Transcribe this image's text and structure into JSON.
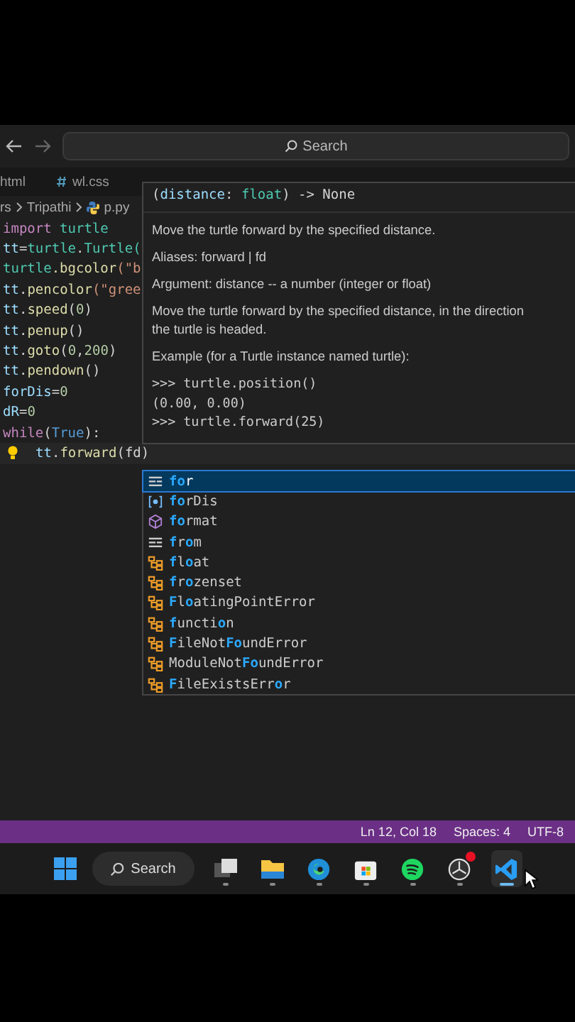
{
  "title_bar": {
    "search_label": "Search"
  },
  "tabs": [
    {
      "label": "html",
      "kind": "html",
      "selected": false
    },
    {
      "label": "wl.css",
      "kind": "css",
      "selected": false
    }
  ],
  "breadcrumbs": [
    "rs",
    "Tripathi",
    "p.py"
  ],
  "code_lines": [
    [
      {
        "text": "import ",
        "kind": "keyword"
      },
      {
        "text": "turtle",
        "kind": "module"
      }
    ],
    [
      {
        "text": "tt",
        "kind": "var"
      },
      {
        "text": "=",
        "kind": "plain"
      },
      {
        "text": "turtle",
        "kind": "module"
      },
      {
        "text": ".",
        "kind": "plain"
      },
      {
        "text": "Turtle(",
        "kind": "class"
      }
    ],
    [
      {
        "text": "turtle",
        "kind": "module"
      },
      {
        "text": ".bgcolor",
        "kind": "func"
      },
      {
        "text": "(\"b",
        "kind": "string"
      }
    ],
    [
      {
        "text": "tt",
        "kind": "var"
      },
      {
        "text": ".",
        "kind": "plain"
      },
      {
        "text": "pencolor",
        "kind": "func"
      },
      {
        "text": "(\"gree",
        "kind": "string"
      }
    ],
    [
      {
        "text": "tt",
        "kind": "var"
      },
      {
        "text": ".",
        "kind": "plain"
      },
      {
        "text": "speed",
        "kind": "func"
      },
      {
        "text": "(",
        "kind": "plain"
      },
      {
        "text": "0",
        "kind": "number"
      },
      {
        "text": ")",
        "kind": "plain"
      }
    ],
    [
      {
        "text": "tt",
        "kind": "var"
      },
      {
        "text": ".",
        "kind": "plain"
      },
      {
        "text": "penup",
        "kind": "func"
      },
      {
        "text": "()",
        "kind": "plain"
      }
    ],
    [
      {
        "text": "tt",
        "kind": "var"
      },
      {
        "text": ".",
        "kind": "plain"
      },
      {
        "text": "goto",
        "kind": "func"
      },
      {
        "text": "(",
        "kind": "plain"
      },
      {
        "text": "0",
        "kind": "number"
      },
      {
        "text": ",",
        "kind": "plain"
      },
      {
        "text": "200",
        "kind": "number"
      },
      {
        "text": ")",
        "kind": "plain"
      }
    ],
    [
      {
        "text": "tt",
        "kind": "var"
      },
      {
        "text": ".",
        "kind": "plain"
      },
      {
        "text": "pendown",
        "kind": "func"
      },
      {
        "text": "()",
        "kind": "plain"
      }
    ],
    [
      {
        "text": "forDis",
        "kind": "var"
      },
      {
        "text": "=",
        "kind": "plain"
      },
      {
        "text": "0",
        "kind": "number"
      }
    ],
    [
      {
        "text": "dR",
        "kind": "var"
      },
      {
        "text": "=",
        "kind": "plain"
      },
      {
        "text": "0",
        "kind": "number"
      }
    ],
    [
      {
        "text": "while",
        "kind": "keyword"
      },
      {
        "text": "(",
        "kind": "plain"
      },
      {
        "text": "True",
        "kind": "const"
      },
      {
        "text": "):",
        "kind": "plain"
      }
    ],
    [
      {
        "text": "tt",
        "kind": "var"
      },
      {
        "text": ".",
        "kind": "plain"
      },
      {
        "text": "forward",
        "kind": "func"
      },
      {
        "text": "(fd)",
        "kind": "plain"
      }
    ]
  ],
  "hover": {
    "signature": [
      {
        "text": "(",
        "kind": "plain"
      },
      {
        "text": "distance",
        "kind": "param"
      },
      {
        "text": ": ",
        "kind": "plain"
      },
      {
        "text": "float",
        "kind": "class"
      },
      {
        "text": ") -> None",
        "kind": "plain"
      }
    ],
    "paragraphs": [
      "Move the turtle forward by the specified distance.",
      "Aliases: forward | fd",
      "Argument: distance -- a number (integer or float)",
      "Move the turtle forward by the specified distance, in the direction\nthe turtle is headed.",
      "Example (for a Turtle instance named turtle):"
    ],
    "example": [
      ">>> turtle.position()",
      "(0.00, 0.00)",
      ">>> turtle.forward(25)"
    ]
  },
  "suggestions": [
    {
      "kind": "keyword",
      "selected": true,
      "parts": [
        {
          "text": "fo",
          "match": true
        },
        {
          "text": "r",
          "match": false
        }
      ]
    },
    {
      "kind": "variable",
      "selected": false,
      "parts": [
        {
          "text": "fo",
          "match": true
        },
        {
          "text": "rDis",
          "match": false
        }
      ]
    },
    {
      "kind": "module",
      "selected": false,
      "parts": [
        {
          "text": "fo",
          "match": true
        },
        {
          "text": "rmat",
          "match": false
        }
      ]
    },
    {
      "kind": "keyword",
      "selected": false,
      "parts": [
        {
          "text": "f",
          "match": true
        },
        {
          "text": "r",
          "match": false
        },
        {
          "text": "o",
          "match": true
        },
        {
          "text": "m",
          "match": false
        }
      ]
    },
    {
      "kind": "class",
      "selected": false,
      "parts": [
        {
          "text": "f",
          "match": true
        },
        {
          "text": "l",
          "match": false
        },
        {
          "text": "o",
          "match": true
        },
        {
          "text": "at",
          "match": false
        }
      ]
    },
    {
      "kind": "class",
      "selected": false,
      "parts": [
        {
          "text": "f",
          "match": true
        },
        {
          "text": "r",
          "match": false
        },
        {
          "text": "o",
          "match": true
        },
        {
          "text": "zenset",
          "match": false
        }
      ]
    },
    {
      "kind": "class",
      "selected": false,
      "parts": [
        {
          "text": "F",
          "match": true
        },
        {
          "text": "l",
          "match": false
        },
        {
          "text": "o",
          "match": true
        },
        {
          "text": "atingPointError",
          "match": false
        }
      ]
    },
    {
      "kind": "class",
      "selected": false,
      "parts": [
        {
          "text": "f",
          "match": true
        },
        {
          "text": "uncti",
          "match": false
        },
        {
          "text": "o",
          "match": true
        },
        {
          "text": "n",
          "match": false
        }
      ]
    },
    {
      "kind": "class",
      "selected": false,
      "parts": [
        {
          "text": "F",
          "match": true
        },
        {
          "text": "ileNot",
          "match": false
        },
        {
          "text": "Fo",
          "match": true
        },
        {
          "text": "undError",
          "match": false
        }
      ]
    },
    {
      "kind": "class",
      "selected": false,
      "parts": [
        {
          "text": "ModuleNot",
          "match": false
        },
        {
          "text": "Fo",
          "match": true
        },
        {
          "text": "undError",
          "match": false
        }
      ]
    },
    {
      "kind": "class",
      "selected": false,
      "parts": [
        {
          "text": "F",
          "match": true
        },
        {
          "text": "ileExistsErr",
          "match": false
        },
        {
          "text": "o",
          "match": true
        },
        {
          "text": "r",
          "match": false
        }
      ]
    }
  ],
  "status_bar": [
    "Ln 12, Col 18",
    "Spaces: 4",
    "UTF-8"
  ],
  "taskbar": {
    "search_label": "Search",
    "apps": [
      {
        "kind": "taskview",
        "active": false,
        "badge": false
      },
      {
        "kind": "folder",
        "active": false,
        "badge": false
      },
      {
        "kind": "edge",
        "active": false,
        "badge": false
      },
      {
        "kind": "store",
        "active": false,
        "badge": false
      },
      {
        "kind": "spotify",
        "active": false,
        "badge": false
      },
      {
        "kind": "obs",
        "active": false,
        "badge": true
      },
      {
        "kind": "vscode",
        "active": true,
        "badge": false
      }
    ]
  }
}
